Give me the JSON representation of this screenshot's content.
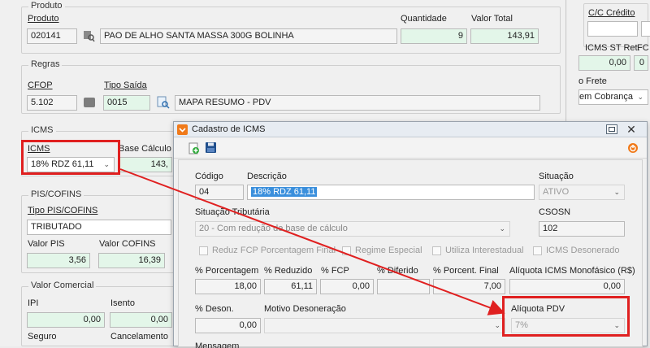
{
  "produto_group": {
    "title": "Produto",
    "produto_label": "Produto",
    "quantidade_label": "Quantidade",
    "valor_total_label": "Valor Total",
    "codigo": "020141",
    "descricao": "PAO DE ALHO SANTA MASSA 300G BOLINHA",
    "quantidade": "9",
    "valor_total": "143,91"
  },
  "regras_group": {
    "title": "Regras",
    "cfop_label": "CFOP",
    "tipo_saida_label": "Tipo Saída",
    "cfop": "5.102",
    "tipo_saida_code": "0015",
    "tipo_saida_desc": "MAPA RESUMO - PDV"
  },
  "icms_group": {
    "title": "ICMS",
    "icms_label": "ICMS",
    "base_calculo_label": "Base Cálculo",
    "icms_value": "18%  RDZ 61,11",
    "base_calculo": "143,"
  },
  "pis_group": {
    "title": "PIS/COFINS",
    "tipo_label": "Tipo PIS/COFINS",
    "tipo_value": "TRIBUTADO",
    "valor_pis_label": "Valor PIS",
    "valor_cofins_label": "Valor COFINS",
    "valor_pis": "3,56",
    "valor_cofins": "16,39"
  },
  "comercial_group": {
    "title": "Valor Comercial",
    "ipi_label": "IPI",
    "isento_label": "Isento",
    "ipi": "0,00",
    "isento": "0,00",
    "seguro_label": "Seguro",
    "cancelamento_label": "Cancelamento"
  },
  "right_panel": {
    "cc_credito_label": "C/C Crédito",
    "icms_st_ret_label": "ICMS ST Ret.",
    "fc_label": "FC",
    "icms_st_ret": "0,00",
    "fc": "0",
    "tipo_frete_label": "o Frete",
    "frete_value": "em Cobrança"
  },
  "dialog": {
    "title": "Cadastro de ICMS",
    "codigo_label": "Código",
    "descricao_label": "Descrição",
    "situacao_label": "Situação",
    "codigo": "04",
    "descricao": "18%  RDZ 61,11",
    "situacao": "ATIVO",
    "situacao_tributaria_label": "Situação Tributária",
    "csosn_label": "CSOSN",
    "situacao_tributaria": "20 - Com redução de base de cálculo",
    "csosn": "102",
    "checks": [
      "Reduz FCP Porcentagem Final",
      "Regime Especial",
      "Utiliza Interestadual",
      "ICMS Desonerado"
    ],
    "pct_label": "% Porcentagem",
    "reduzido_label": "% Reduzido",
    "fcp_label": "% FCP",
    "diferido_label": "% Diferido",
    "porcent_final_label": "% Porcent. Final",
    "aliquota_mono_label": "Alíquota ICMS Monofásico (R$)",
    "pct": "18,00",
    "reduzido": "61,11",
    "fcp": "0,00",
    "diferido": "",
    "porcent_final": "7,00",
    "aliquota_mono": "0,00",
    "deson_label": "% Deson.",
    "motivo_label": "Motivo Desoneração",
    "aliquota_pdv_label": "Alíquota PDV",
    "deson": "0,00",
    "aliquota_pdv": "7%",
    "mensagem_label": "Mensagem"
  },
  "colors": {
    "highlight_red": "#e02020",
    "green_field": "#e3f6e9",
    "selection_blue": "#3a8fdc"
  }
}
